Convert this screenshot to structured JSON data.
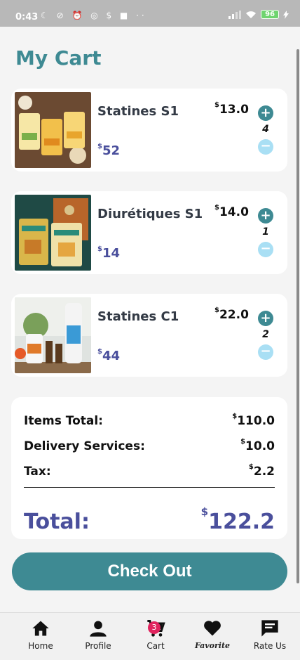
{
  "status_bar": {
    "time": "0:43",
    "left_icons": "☾ ⊘ ⏰ ◎ $ ■ ··",
    "battery": "96"
  },
  "page": {
    "title": "My Cart"
  },
  "cart_items": [
    {
      "name": "Statines S1",
      "price": "13.0",
      "quantity": "4",
      "subtotal": "52"
    },
    {
      "name": "Diurétiques S1",
      "price": "14.0",
      "quantity": "1",
      "subtotal": "14"
    },
    {
      "name": "Statines C1",
      "price": "22.0",
      "quantity": "2",
      "subtotal": "44"
    }
  ],
  "summary": {
    "items_total_label": "Items Total:",
    "items_total_value": "110.0",
    "delivery_label": "Delivery Services:",
    "delivery_value": "10.0",
    "tax_label": "Tax:",
    "tax_value": "2.2",
    "total_label": "Total:",
    "total_value": "122.2",
    "currency": "$"
  },
  "checkout_label": "Check Out",
  "bottom_nav": {
    "items": [
      {
        "label": "Home",
        "icon": "home-icon"
      },
      {
        "label": "Profile",
        "icon": "person-icon"
      },
      {
        "label": "Cart",
        "icon": "cart-icon",
        "badge": "3"
      },
      {
        "label": "Favorite",
        "icon": "heart-icon"
      },
      {
        "label": "Rate Us",
        "icon": "chat-icon"
      }
    ]
  },
  "colors": {
    "accent": "#3e8a93",
    "price_text": "#4a4f9c",
    "minus_button": "#a9dff4",
    "badge": "#e0245e"
  }
}
